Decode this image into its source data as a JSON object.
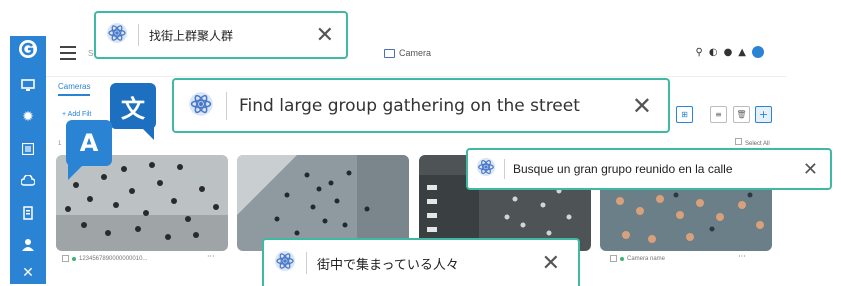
{
  "header": {
    "camera_title": "Camera",
    "search_placeholder": "Se"
  },
  "tabs": [
    "Cameras"
  ],
  "toolbar": {
    "add_filter": "+ Add Filt",
    "result_count": "1",
    "select_all": "Select All"
  },
  "cameras": [
    {
      "name": "1234567890000000010...",
      "status": "online"
    },
    {
      "name": "",
      "status": "online"
    },
    {
      "name": "",
      "status": "online"
    },
    {
      "name": "Camera name",
      "status": "online"
    }
  ],
  "bubbles": {
    "source_letter": "A",
    "target_glyph": "文"
  },
  "queries": {
    "chinese": "找街上群聚人群",
    "english": "Find large group gathering on the street",
    "spanish": "Busque un gran grupo reunido en la calle",
    "japanese": "街中で集まっている人々"
  },
  "colors": {
    "accent": "#2b84d3",
    "card_border": "#3fb8a4",
    "online": "#3cb371"
  }
}
